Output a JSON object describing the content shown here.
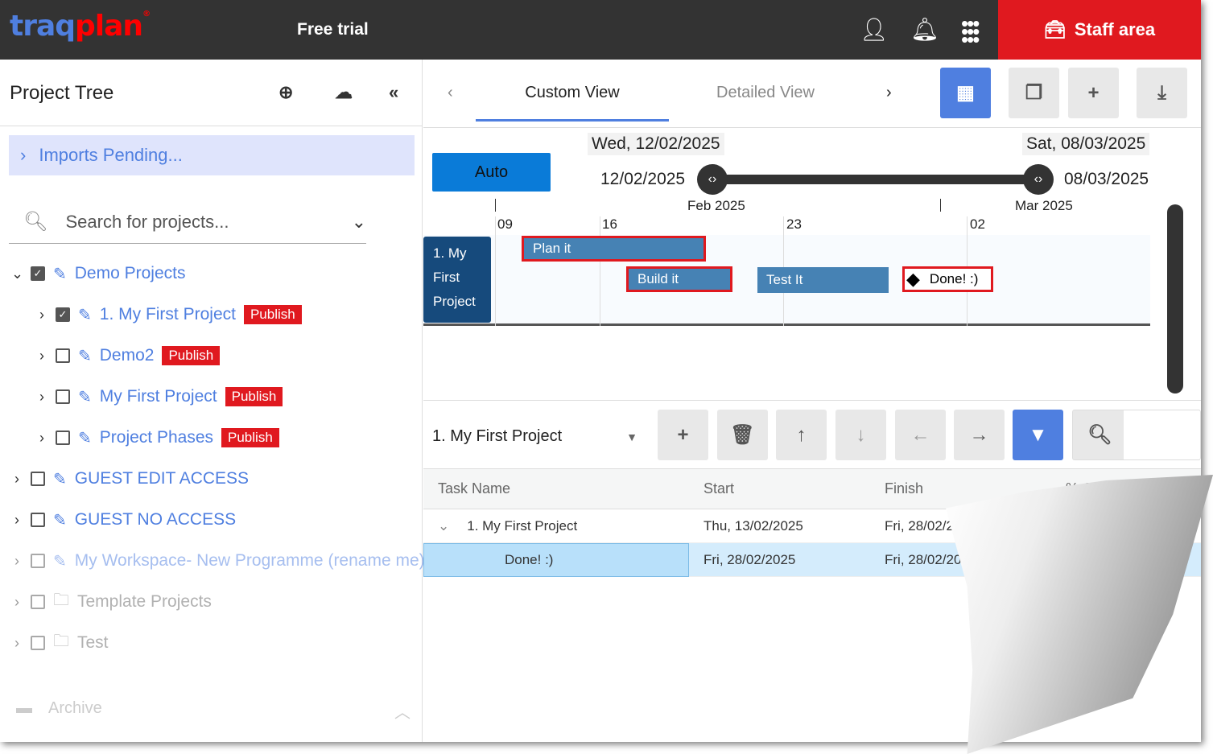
{
  "header": {
    "logo_a": "traq",
    "logo_b": "plan",
    "free_trial": "Free trial",
    "staff_area": "Staff area",
    "colors": {
      "bg": "#333333",
      "staff": "#e0191f",
      "brand_blue": "#4f7fe0"
    }
  },
  "left": {
    "title": "Project Tree",
    "imports": "Imports Pending...",
    "search_placeholder": "Search for projects...",
    "items": [
      {
        "label": "Demo Projects",
        "checked": true,
        "expanded": true,
        "level": 0
      },
      {
        "label": "1. My First Project",
        "checked": true,
        "level": 1,
        "badge": "Publish"
      },
      {
        "label": "Demo2",
        "checked": false,
        "level": 1,
        "badge": "Publish"
      },
      {
        "label": "My First Project",
        "checked": false,
        "level": 1,
        "badge": "Publish"
      },
      {
        "label": "Project Phases",
        "checked": false,
        "level": 1,
        "badge": "Publish"
      },
      {
        "label": "GUEST EDIT ACCESS",
        "checked": false,
        "level": 0
      },
      {
        "label": "GUEST NO ACCESS",
        "checked": false,
        "level": 0
      },
      {
        "label": "My Workspace- New Programme (rename me)",
        "checked": false,
        "level": 0
      },
      {
        "label": "Template Projects",
        "checked": false,
        "level": 0,
        "folder": true
      },
      {
        "label": "Test",
        "checked": false,
        "level": 0,
        "folder": true
      }
    ],
    "archive": "Archive"
  },
  "right": {
    "tabs": [
      "Custom View",
      "Detailed View"
    ],
    "active_tab": "Custom View",
    "gantt": {
      "start_box": "Wed, 12/02/2025",
      "end_box": "Sat, 08/03/2025",
      "start_label": "12/02/2025",
      "end_label": "08/03/2025",
      "auto": "Auto",
      "months": [
        "Feb 2025",
        "Mar 2025"
      ],
      "weeks": [
        "09",
        "16",
        "23",
        "02"
      ],
      "lane": "1. My First Project",
      "tasks": [
        {
          "name": "Plan it"
        },
        {
          "name": "Build it"
        },
        {
          "name": "Test It"
        },
        {
          "name": "Done! :)",
          "milestone": true
        }
      ]
    },
    "project_select": "1. My First Project",
    "table": {
      "headers": [
        "Task Name",
        "Start",
        "Finish",
        "% Complete"
      ],
      "rows": [
        {
          "name": "1. My First Project",
          "start": "Thu, 13/02/2025",
          "finish": "Fri, 28/02/2"
        },
        {
          "name": "Done! :)",
          "start": "Fri, 28/02/2025",
          "finish": "Fri, 28/02/20"
        }
      ]
    }
  }
}
